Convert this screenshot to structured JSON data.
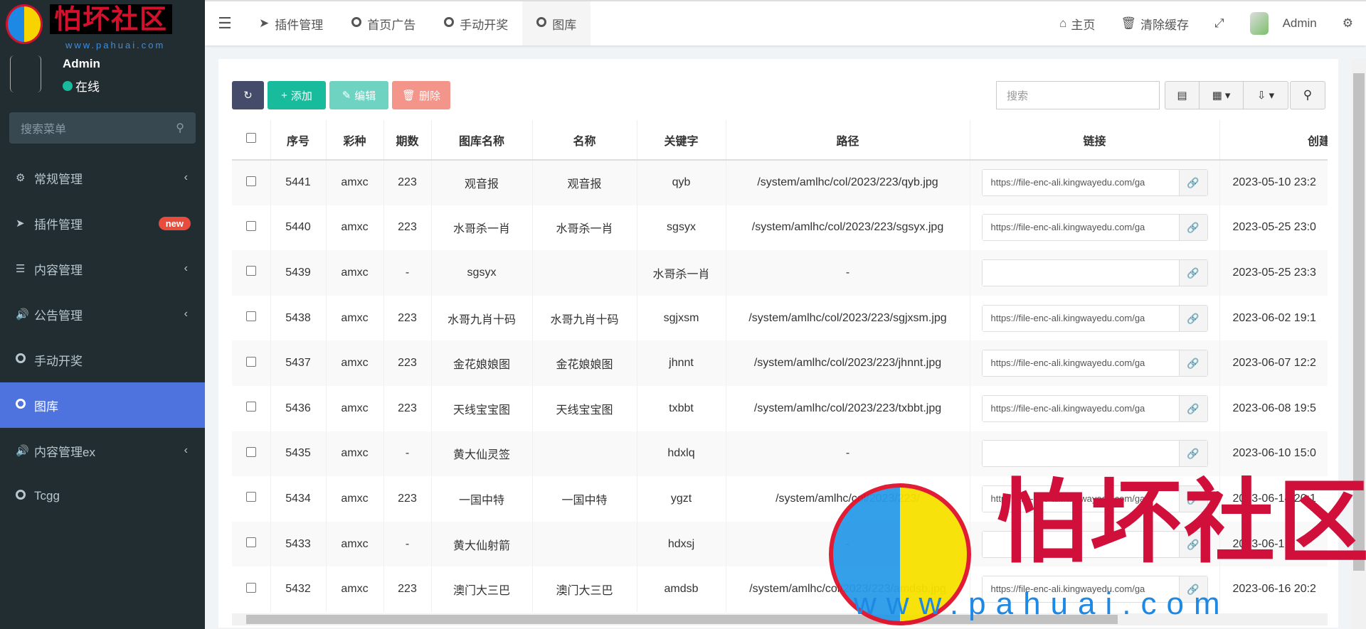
{
  "logo": {
    "title": "怕坏社区",
    "url": "www.pahuai.com"
  },
  "user": {
    "name": "Admin",
    "status": "在线"
  },
  "sidebar": {
    "search_placeholder": "搜索菜单",
    "items": [
      {
        "label": "常规管理",
        "icon": "cogs-icon",
        "chevron": true
      },
      {
        "label": "插件管理",
        "icon": "rocket-icon",
        "badge": "new"
      },
      {
        "label": "内容管理",
        "icon": "list-icon",
        "chevron": true
      },
      {
        "label": "公告管理",
        "icon": "volume-icon",
        "chevron": true
      },
      {
        "label": "手动开奖",
        "icon": "circle-icon"
      },
      {
        "label": "图库",
        "icon": "circle-icon",
        "active": true
      },
      {
        "label": "内容管理ex",
        "icon": "volume-icon",
        "chevron": true
      },
      {
        "label": "Tcgg",
        "icon": "circle-icon"
      }
    ],
    "active_color": "#4e73df"
  },
  "header": {
    "tabs": [
      {
        "label": "插件管理",
        "icon": "rocket-icon"
      },
      {
        "label": "首页广告",
        "icon": "circle-icon"
      },
      {
        "label": "手动开奖",
        "icon": "circle-icon"
      },
      {
        "label": "图库",
        "icon": "circle-icon",
        "active": true
      }
    ],
    "home": "主页",
    "clear_cache": "清除缓存",
    "user": "Admin"
  },
  "toolbar": {
    "add": "添加",
    "edit": "编辑",
    "delete": "删除",
    "search_placeholder": "搜索",
    "colors": {
      "refresh": "#444c69",
      "add": "#18bc9c",
      "edit": "#6fd3c1",
      "delete": "#f3958a"
    }
  },
  "table": {
    "columns": [
      "序号",
      "彩种",
      "期数",
      "图库名称",
      "名称",
      "关键字",
      "路径",
      "链接",
      "创建时间"
    ],
    "rows": [
      [
        "5441",
        "amxc",
        "223",
        "观音报",
        "观音报",
        "qyb",
        "/system/amlhc/col/2023/223/qyb.jpg",
        "https://file-enc-ali.kingwayedu.com/ga",
        "2023-05-10 23:2"
      ],
      [
        "5440",
        "amxc",
        "223",
        "水哥杀一肖",
        "水哥杀一肖",
        "sgsyx",
        "/system/amlhc/col/2023/223/sgsyx.jpg",
        "https://file-enc-ali.kingwayedu.com/ga",
        "2023-05-25 23:0"
      ],
      [
        "5439",
        "amxc",
        "-",
        "sgsyx",
        "",
        "水哥杀一肖",
        "-",
        "",
        "2023-05-25 23:3"
      ],
      [
        "5438",
        "amxc",
        "223",
        "水哥九肖十码",
        "水哥九肖十码",
        "sgjxsm",
        "/system/amlhc/col/2023/223/sgjxsm.jpg",
        "https://file-enc-ali.kingwayedu.com/ga",
        "2023-06-02 19:1"
      ],
      [
        "5437",
        "amxc",
        "223",
        "金花娘娘图",
        "金花娘娘图",
        "jhnnt",
        "/system/amlhc/col/2023/223/jhnnt.jpg",
        "https://file-enc-ali.kingwayedu.com/ga",
        "2023-06-07 12:2"
      ],
      [
        "5436",
        "amxc",
        "223",
        "天线宝宝图",
        "天线宝宝图",
        "txbbt",
        "/system/amlhc/col/2023/223/txbbt.jpg",
        "https://file-enc-ali.kingwayedu.com/ga",
        "2023-06-08 19:5"
      ],
      [
        "5435",
        "amxc",
        "-",
        "黄大仙灵签",
        "",
        "hdxlq",
        "-",
        "",
        "2023-06-10 15:0"
      ],
      [
        "5434",
        "amxc",
        "223",
        "一国中特",
        "一国中特",
        "ygzt",
        "/system/amlhc/col/2023/223/",
        "https://file-enc-ali.kingwayedu.com/ga",
        "2023-06-14 20:1"
      ],
      [
        "5433",
        "amxc",
        "-",
        "黄大仙射箭",
        "",
        "hdxsj",
        "-",
        "",
        "2023-06-1"
      ],
      [
        "5432",
        "amxc",
        "223",
        "澳门大三巴",
        "澳门大三巴",
        "amdsb",
        "/system/amlhc/col/2023/223/amdsb.jpg",
        "https://file-enc-ali.kingwayedu.com/ga",
        "2023-06-16 20:2"
      ]
    ]
  },
  "watermark": {
    "text": "怕坏社区",
    "url": "www.pahuai.com"
  }
}
